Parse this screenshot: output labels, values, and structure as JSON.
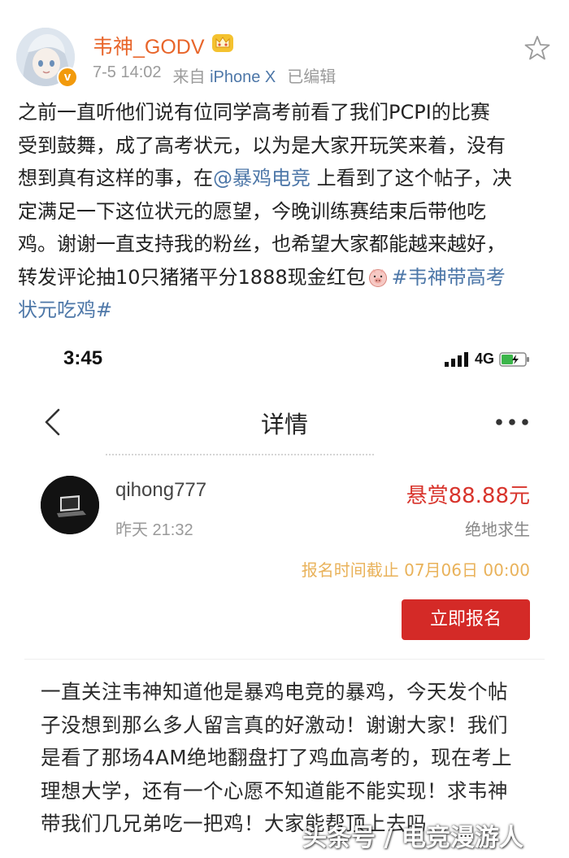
{
  "post": {
    "username": "韦神_GODV",
    "verified_badge": "v",
    "time": "7-5 14:02",
    "source_prefix": "来自",
    "source_device": "iPhone X",
    "edited": "已编辑",
    "body": {
      "line1": "之前一直听他们说有位同学高考前看了我们PCPI的比赛",
      "line2": "受到鼓舞，成了高考状元，以为是大家开玩笑来着，没有",
      "line3_a": "想到真有这样的事，在",
      "line3_mention": "@暴鸡电竞",
      "line3_b": " 上看到了这个帖子，决",
      "line4": "定满足一下这位状元的愿望，今晚训练赛结束后带他吃",
      "line5": "鸡。谢谢一直支持我的粉丝，也希望大家都能越来越好，",
      "line6_a": "转发评论抽10只猪猪平分1888现金红包",
      "hashtag_a": "#韦神带高考",
      "hashtag_b": "状元吃鸡#"
    },
    "icons": [
      "crown-icon",
      "star-icon",
      "pig-icon"
    ]
  },
  "screenshot": {
    "status": {
      "time": "3:45",
      "network": "4G"
    },
    "nav": {
      "title": "详情"
    },
    "poster": {
      "name": "qihong777",
      "time": "昨天 21:32",
      "reward": "悬赏88.88元",
      "game": "绝地求生",
      "deadline": "报名时间截止 07月06日 00:00",
      "signup": "立即报名"
    },
    "detail": {
      "line1": "一直关注韦神知道他是暴鸡电竞的暴鸡，今天发个帖",
      "line2": "子没想到那么多人留言真的好激动！谢谢大家！我们",
      "line3": "是看了那场4AM绝地翻盘打了鸡血高考的，现在考上",
      "line4": "理想大学，还有一个心愿不知道能不能实现！求韦神",
      "line5": "带我们几兄弟吃一把鸡！大家能帮顶上去吗"
    },
    "watermark": "头条号 / 电竞漫游人"
  },
  "colors": {
    "username": "#e8652a",
    "link": "#4d77a8",
    "reward": "#d42a27",
    "deadline": "#e9b25a"
  }
}
